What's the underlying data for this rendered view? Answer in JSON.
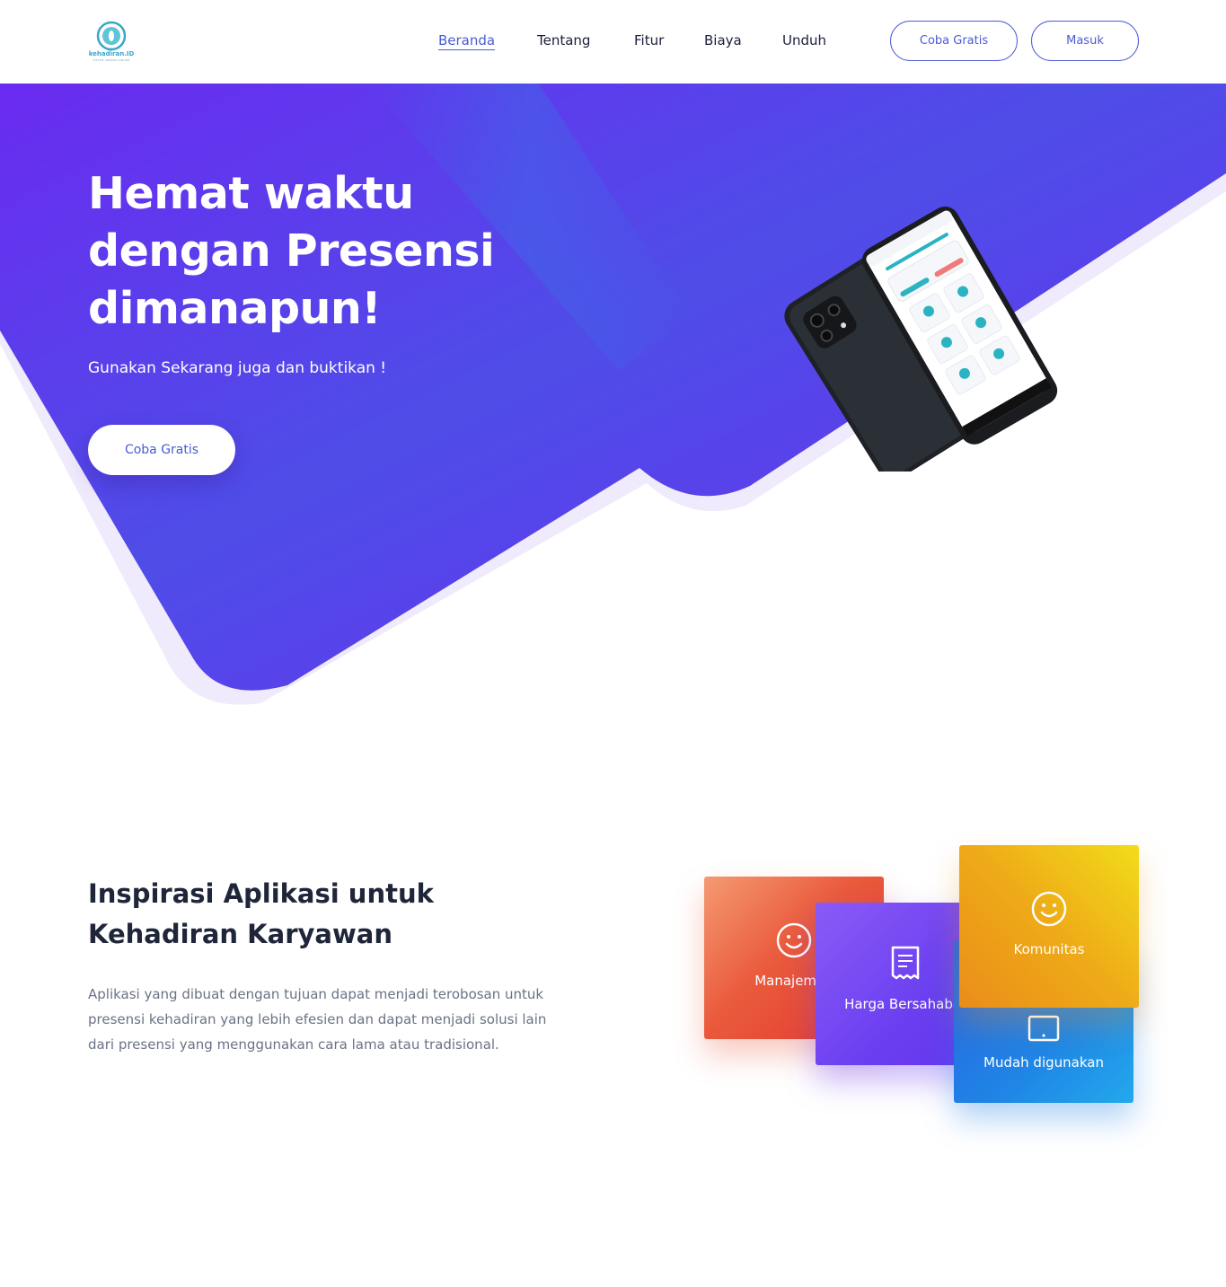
{
  "brand": {
    "logo_text": "kehadiran.ID",
    "logo_tagline": "SISTEM ABSENSI ONLINE"
  },
  "nav": {
    "items": [
      {
        "label": "Beranda",
        "active": true
      },
      {
        "label": "Tentang",
        "active": false
      },
      {
        "label": "Fitur",
        "active": false
      },
      {
        "label": "Biaya",
        "active": false
      },
      {
        "label": "Unduh",
        "active": false
      }
    ],
    "try_free": "Coba Gratis",
    "login": "Masuk"
  },
  "hero": {
    "title_lines": [
      "Hemat waktu",
      "dengan Presensi",
      "dimanapun!"
    ],
    "subtitle": "Gunakan Sekarang juga dan buktikan !",
    "cta": "Coba Gratis",
    "phone_image": "phone-app-mockup"
  },
  "inspiration": {
    "title_lines": [
      "Inspirasi Aplikasi untuk",
      "Kehadiran Karyawan"
    ],
    "body_lines": [
      "Aplikasi yang dibuat dengan tujuan dapat menjadi terobosan untuk",
      "presensi kehadiran yang lebih efesien dan dapat menjadi solusi lain",
      "dari presensi yang menggunakan cara lama atau tradisional."
    ],
    "cards": [
      {
        "label": "Manajemen",
        "icon": "smile-icon"
      },
      {
        "label": "Harga Bersahabat",
        "icon": "receipt-icon"
      },
      {
        "label": "Mudah digunakan",
        "icon": "tablet-icon"
      },
      {
        "label": "Komunitas",
        "icon": "smile-icon"
      }
    ]
  },
  "colors": {
    "accent": "#4a5bd4",
    "hero_purple": "#6a2bf0",
    "hero_blue": "#3e63e6",
    "text_dark": "#20263a",
    "text_muted": "#6b7285"
  }
}
